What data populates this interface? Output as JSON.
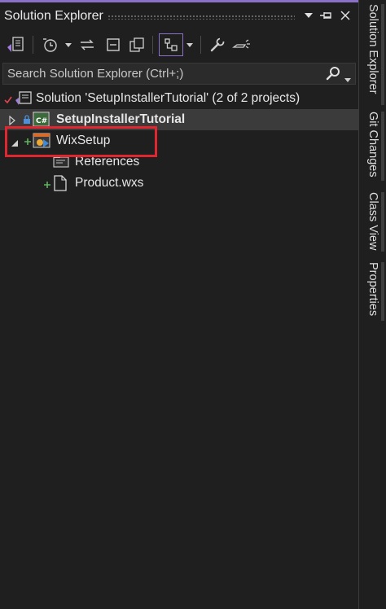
{
  "panel": {
    "title": "Solution Explorer"
  },
  "search": {
    "placeholder": "Search Solution Explorer (Ctrl+;)"
  },
  "tree": {
    "solution_label": "Solution 'SetupInstallerTutorial' (2 of 2 projects)",
    "project1_label": "SetupInstallerTutorial",
    "project2_label": "WixSetup",
    "references_label": "References",
    "file_label": "Product.wxs"
  },
  "side_tabs": [
    "Solution Explorer",
    "Git Changes",
    "Class View",
    "Properties"
  ],
  "colors": {
    "accent": "#8a71c7",
    "highlight": "#e0262f",
    "background": "#1f1f1f"
  }
}
